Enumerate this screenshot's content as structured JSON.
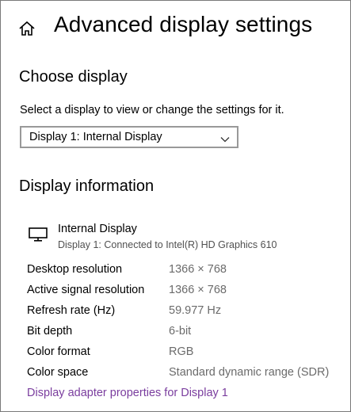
{
  "header": {
    "title": "Advanced display settings",
    "home_icon": "home-icon"
  },
  "choose_display": {
    "title": "Choose display",
    "prompt": "Select a display to view or change the settings for it.",
    "selected": "Display 1: Internal Display",
    "chevron_icon": "chevron-down-icon"
  },
  "display_info": {
    "title": "Display information",
    "monitor_icon": "monitor-icon",
    "display_name": "Internal Display",
    "display_subtitle": "Display 1: Connected to Intel(R) HD Graphics 610",
    "rows": [
      {
        "label": "Desktop resolution",
        "value": "1366 × 768"
      },
      {
        "label": "Active signal resolution",
        "value": "1366 × 768"
      },
      {
        "label": "Refresh rate (Hz)",
        "value": "59.977 Hz"
      },
      {
        "label": "Bit depth",
        "value": "6-bit"
      },
      {
        "label": "Color format",
        "value": "RGB"
      },
      {
        "label": "Color space",
        "value": "Standard dynamic range (SDR)"
      }
    ],
    "adapter_link": "Display adapter properties for Display 1"
  },
  "colors": {
    "link": "#7a3d9e",
    "value_text": "#6b6b6b",
    "border": "#999999"
  }
}
